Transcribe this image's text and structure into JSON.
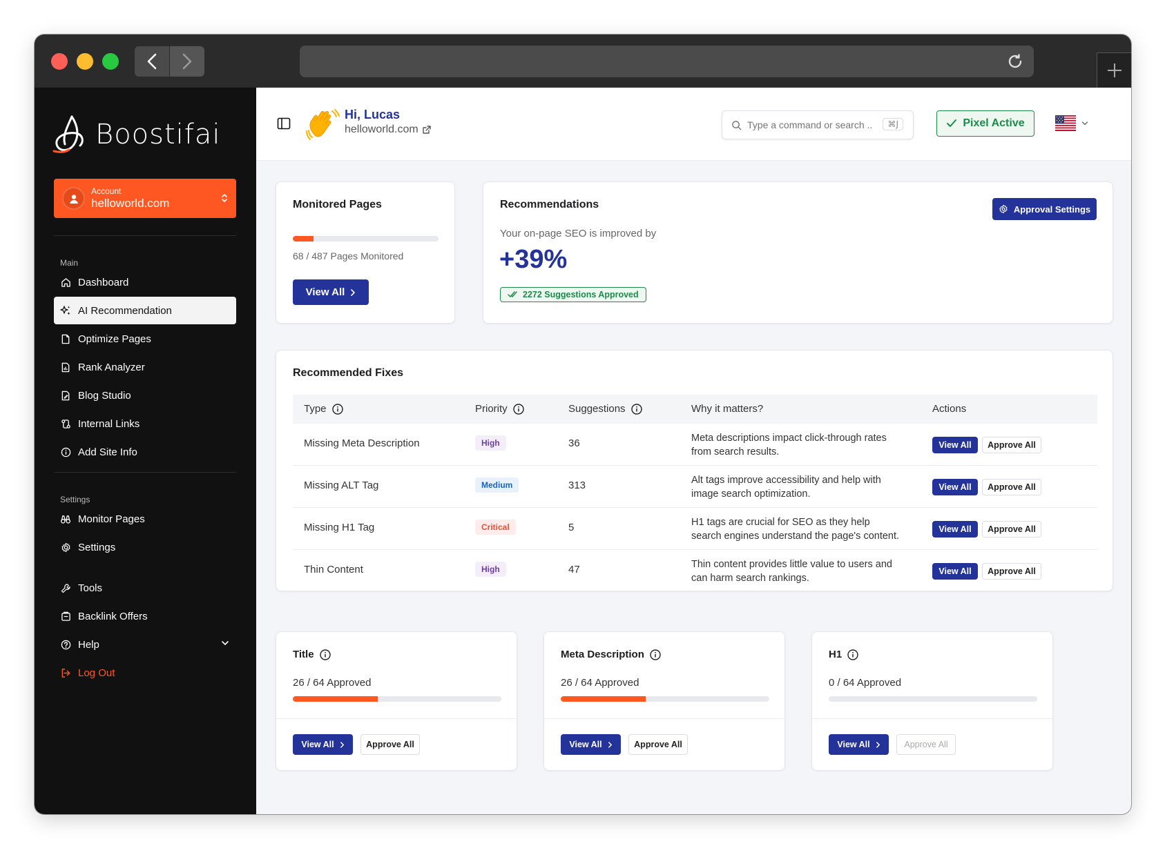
{
  "sidebar": {
    "brand": "Boostifai",
    "account": {
      "label": "Account",
      "domain": "helloworld.com"
    },
    "sections": {
      "main": "Main",
      "settings": "Settings"
    },
    "main_items": [
      {
        "label": "Dashboard",
        "icon": "home-icon"
      },
      {
        "label": "AI Recommendation",
        "icon": "sparkles-icon"
      },
      {
        "label": "Optimize Pages",
        "icon": "file-icon"
      },
      {
        "label": "Rank Analyzer",
        "icon": "file-chart-icon"
      },
      {
        "label": "Blog Studio",
        "icon": "file-edit-icon"
      },
      {
        "label": "Internal Links",
        "icon": "link-icon"
      },
      {
        "label": "Add Site Info",
        "icon": "info-icon"
      }
    ],
    "settings_items": [
      {
        "label": "Monitor Pages",
        "icon": "binoculars-icon"
      },
      {
        "label": "Settings",
        "icon": "gear-icon"
      }
    ],
    "other_items": [
      {
        "label": "Tools",
        "icon": "wrench-icon"
      },
      {
        "label": "Backlink Offers",
        "icon": "wallet-icon"
      },
      {
        "label": "Help",
        "icon": "help-icon"
      },
      {
        "label": "Log Out",
        "icon": "logout-icon"
      }
    ]
  },
  "header": {
    "greeting": "Hi, Lucas",
    "domain": "helloworld.com",
    "search_placeholder": "Type a command or search ...",
    "shortcut": "⌘J",
    "pixel_status": "Pixel Active",
    "flag": "us-flag-icon"
  },
  "monitored": {
    "title": "Monitored Pages",
    "progress": 0.14,
    "caption": "68 / 487 Pages Monitored",
    "button": "View All"
  },
  "recommendations": {
    "title": "Recommendations",
    "settings_button": "Approval Settings",
    "subtitle": "Your on-page SEO is improved by",
    "value": "+39%",
    "badge": "2272 Suggestions Approved"
  },
  "fixes": {
    "title": "Recommended Fixes",
    "columns": {
      "type": "Type",
      "priority": "Priority",
      "suggestions": "Suggestions",
      "why": "Why it matters?",
      "actions": "Actions"
    },
    "view_label": "View All",
    "approve_label": "Approve All",
    "rows": [
      {
        "type": "Missing Meta Description",
        "priority": "High",
        "priority_color": "#6b3fa0",
        "priority_bg": "#f3eefa",
        "suggestions": "36",
        "why": "Meta descriptions impact click-through rates from search results."
      },
      {
        "type": "Missing ALT Tag",
        "priority": "Medium",
        "priority_color": "#1565c0",
        "priority_bg": "#e8f1fc",
        "suggestions": "313",
        "why": "Alt tags improve accessibility and help with image search optimization."
      },
      {
        "type": "Missing H1 Tag",
        "priority": "Critical",
        "priority_color": "#e0513a",
        "priority_bg": "#fdecea",
        "suggestions": "5",
        "why": "H1 tags are crucial for SEO as they help search engines understand the page's content."
      },
      {
        "type": "Thin Content",
        "priority": "High",
        "priority_color": "#6b3fa0",
        "priority_bg": "#f3eefa",
        "suggestions": "47",
        "why": "Thin content provides little value to users and can harm search rankings."
      }
    ]
  },
  "metric_cards": [
    {
      "title": "Title",
      "caption": "26 / 64 Approved",
      "progress": 0.406,
      "view": "View All",
      "approve": "Approve All",
      "approve_enabled": true
    },
    {
      "title": "Meta Description",
      "caption": "26 / 64 Approved",
      "progress": 0.406,
      "view": "View All",
      "approve": "Approve All",
      "approve_enabled": true
    },
    {
      "title": "H1",
      "caption": "0 / 64 Approved",
      "progress": 0.0,
      "view": "View All",
      "approve": "Approve All",
      "approve_enabled": false
    }
  ],
  "colors": {
    "accent": "#24339a",
    "brand": "#ff5722",
    "success": "#1b8a4a"
  }
}
